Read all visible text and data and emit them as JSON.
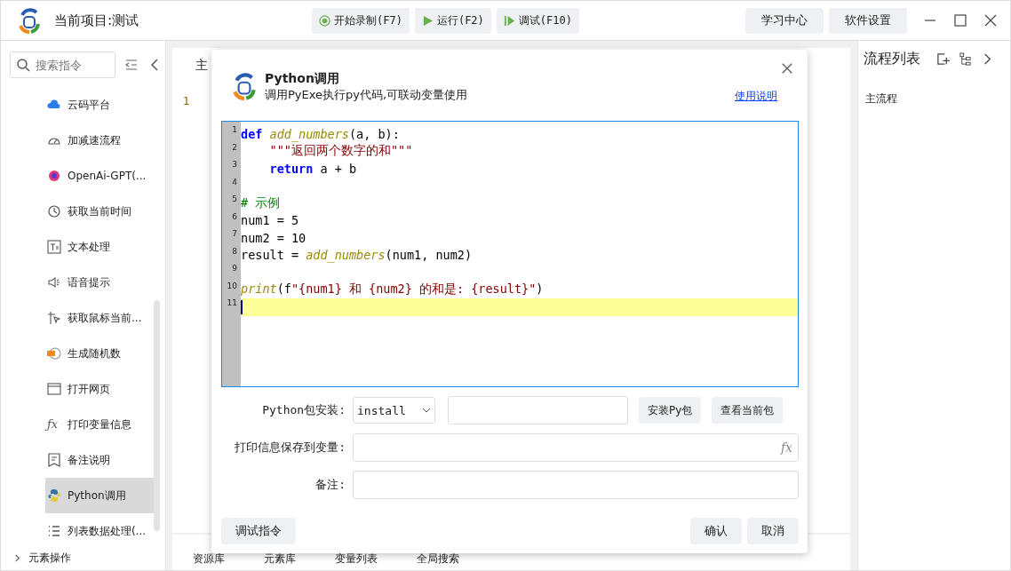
{
  "window": {
    "title": "当前项目:测试"
  },
  "toolbar": [
    {
      "label": "开始录制(F7)",
      "kind": "record"
    },
    {
      "label": "运行(F2)",
      "kind": "run"
    },
    {
      "label": "调试(F10)",
      "kind": "debug"
    }
  ],
  "top_buttons": [
    "学习中心",
    "软件设置"
  ],
  "sidebar": {
    "search": {
      "placeholder": "搜索指令"
    },
    "items": [
      {
        "label": "云码平台",
        "kind": "cloud",
        "selected": false
      },
      {
        "label": "加减速流程",
        "kind": "gauge",
        "selected": false
      },
      {
        "label": "OpenAi-GPT(...",
        "kind": "gpt",
        "selected": false
      },
      {
        "label": "获取当前时间",
        "kind": "clock",
        "selected": false
      },
      {
        "label": "文本处理",
        "kind": "text",
        "selected": false
      },
      {
        "label": "语音提示",
        "kind": "speaker",
        "selected": false
      },
      {
        "label": "获取鼠标当前...",
        "kind": "cursor",
        "selected": false
      },
      {
        "label": "生成随机数",
        "kind": "random",
        "selected": false
      },
      {
        "label": "打开网页",
        "kind": "browser",
        "selected": false
      },
      {
        "label": "打印变量信息",
        "kind": "fx",
        "glyph": "ƒx",
        "selected": false
      },
      {
        "label": "备注说明",
        "kind": "note",
        "selected": false
      },
      {
        "label": "Python调用",
        "kind": "python",
        "selected": true
      },
      {
        "label": "列表数据处理(...",
        "kind": "list",
        "selected": false
      }
    ],
    "section": {
      "label": "元素操作",
      "expanded": false
    }
  },
  "editor": {
    "tab": "主",
    "line_number": "1"
  },
  "bottom_tabs": [
    "资源库",
    "元素库",
    "变量列表",
    "全局搜索"
  ],
  "right_panel": {
    "title": "流程列表",
    "items": [
      "主流程"
    ]
  },
  "dialog": {
    "title": "Python调用",
    "subtitle": "调用PyExe执行py代码,可联动变量使用",
    "help_link": "使用说明",
    "code": [
      {
        "number": "1",
        "current": false,
        "tokens": [
          {
            "kind": "keyword",
            "text": "def"
          },
          {
            "kind": "func",
            "text": " add_numbers"
          },
          {
            "kind": "plain",
            "text": "(a, b):"
          }
        ]
      },
      {
        "number": "2",
        "current": false,
        "tokens": [
          {
            "kind": "string",
            "text": "    \"\"\"返回两个数字的和\"\"\""
          }
        ]
      },
      {
        "number": "3",
        "current": false,
        "tokens": [
          {
            "kind": "keyword",
            "text": "    return"
          },
          {
            "kind": "plain",
            "text": " a + b"
          }
        ]
      },
      {
        "number": "4",
        "current": false
      },
      {
        "number": "5",
        "current": false,
        "tokens": [
          {
            "kind": "comment",
            "text": "# 示例"
          }
        ]
      },
      {
        "number": "6",
        "current": false,
        "tokens": [
          {
            "kind": "plain",
            "text": "num1 = 5"
          }
        ]
      },
      {
        "number": "7",
        "current": false,
        "tokens": [
          {
            "kind": "plain",
            "text": "num2 = 10"
          }
        ]
      },
      {
        "number": "8",
        "current": false,
        "tokens": [
          {
            "kind": "plain",
            "text": "result = "
          },
          {
            "kind": "func",
            "text": "add_numbers"
          },
          {
            "kind": "plain",
            "text": "(num1, num2)"
          }
        ]
      },
      {
        "number": "9",
        "current": false
      },
      {
        "number": "10",
        "current": false,
        "tokens": [
          {
            "kind": "func",
            "text": "print"
          },
          {
            "kind": "plain",
            "text": "(f"
          },
          {
            "kind": "string",
            "text": "\"{num1} 和 {num2} 的和是: {result}\""
          },
          {
            "kind": "plain",
            "text": ")"
          }
        ]
      },
      {
        "number": "11",
        "current": true
      }
    ],
    "install": {
      "label": "Python包安装:",
      "mode": "install",
      "install_button": "安装Py包",
      "view_button": "查看当前包"
    },
    "save_var": {
      "label": "打印信息保存到变量:",
      "fx": "fx"
    },
    "remark": {
      "label": "备注:"
    },
    "debug_button": "调试指令",
    "ok_button": "确认",
    "cancel_button": "取消"
  }
}
